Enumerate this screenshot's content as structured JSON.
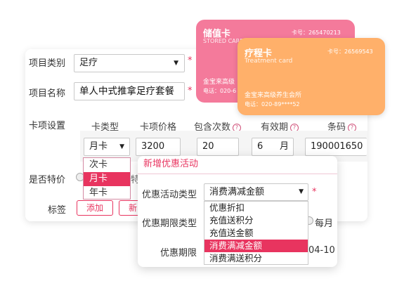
{
  "colors": {
    "accent": "#e8345f",
    "stored_card": "#f47a9b",
    "treatment_card": "#ffb06a"
  },
  "form": {
    "category_label": "项目类别",
    "category_value": "足疗",
    "name_label": "项目名称",
    "name_value": "单人中式推拿足疗套餐",
    "card_settings_label": "卡项设置",
    "required_mark": "*",
    "columns": {
      "card_type": "卡类型",
      "price": "卡项价格",
      "times": "包含次数",
      "validity": "有效期",
      "barcode": "条码"
    },
    "row": {
      "card_type": "月卡",
      "price": "3200",
      "times": "20",
      "validity_num": "6",
      "validity_unit": "月",
      "barcode": "190001650"
    },
    "card_type_options": [
      "次卡",
      "月卡",
      "年卡"
    ],
    "card_type_selected": "月卡",
    "special_price_label": "是否特价",
    "special_price_fragment": "特",
    "tags_label": "标签",
    "add_tag_button": "添加",
    "second_tag_button": "新品",
    "help_icon": "question-circle-icon",
    "caret_icon": "caret-down-icon"
  },
  "promo_dialog": {
    "title": "新增优惠活动",
    "activity_type_label": "优惠活动类型",
    "activity_type_value": "消费满减金额",
    "period_type_label": "优惠期限类型",
    "period_option_monthly": "每月",
    "period_label": "优惠期限",
    "period_value_fragment": "04-10",
    "options": [
      "优惠折扣",
      "充值送积分",
      "充值送金额",
      "消费满减金额",
      "消费满送积分"
    ],
    "selected_option": "消费满减金额"
  },
  "stored_card": {
    "title": "储值卡",
    "subtitle": "STORED CARDS",
    "number_label": "卡号：265470213",
    "store_fragment": "金宝来高级",
    "phone_fragment": "电话：020-6"
  },
  "treatment_card": {
    "title": "疗程卡",
    "subtitle": "Treatment card",
    "number_label": "卡号：26569543",
    "store": "金宝来高级养生会所",
    "phone": "电话：020-89****52"
  }
}
